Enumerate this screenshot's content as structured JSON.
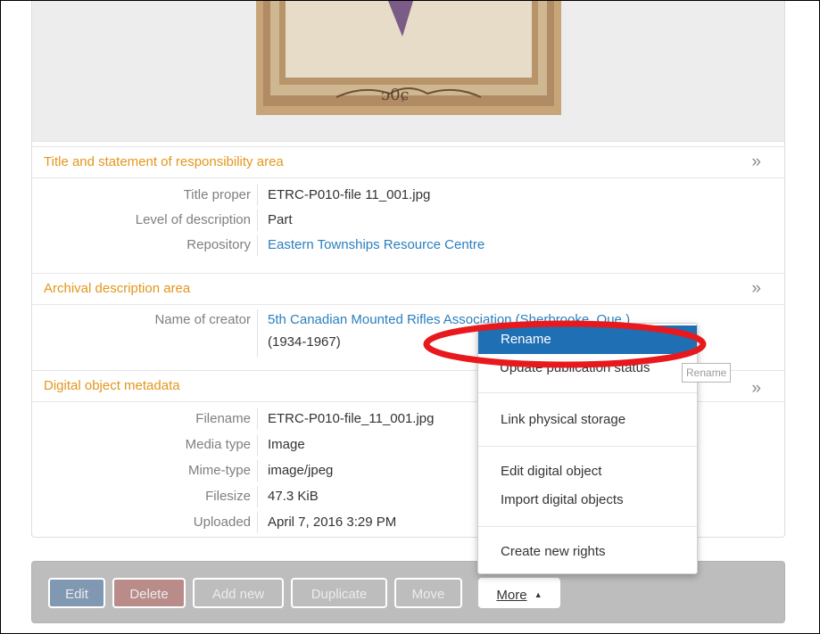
{
  "sections": {
    "title_area": {
      "title": "Title and statement of responsibility area",
      "fields": [
        {
          "label": "Title proper",
          "value": "ETRC-P010-file 11_001.jpg"
        },
        {
          "label": "Level of description",
          "value": "Part"
        },
        {
          "label": "Repository",
          "value": "Eastern Townships Resource Centre"
        }
      ]
    },
    "archival_area": {
      "title": "Archival description area",
      "fields": [
        {
          "label": "Name of creator",
          "value": "5th Canadian Mounted Rifles Association (Sherbrooke, Que.)",
          "value_line2": "(1934-1967)"
        }
      ]
    },
    "digital_area": {
      "title": "Digital object metadata",
      "fields": [
        {
          "label": "Filename",
          "value": "ETRC-P010-file_11_001.jpg"
        },
        {
          "label": "Media type",
          "value": "Image"
        },
        {
          "label": "Mime-type",
          "value": "image/jpeg"
        },
        {
          "label": "Filesize",
          "value": "47.3 KiB"
        },
        {
          "label": "Uploaded",
          "value": "April 7, 2016 3:29 PM"
        }
      ]
    },
    "chevron": "»"
  },
  "toolbar": {
    "edit": "Edit",
    "delete": "Delete",
    "add_new": "Add new",
    "duplicate": "Duplicate",
    "move": "Move",
    "more": "More",
    "more_caret": "▲"
  },
  "menu": {
    "items": [
      "Rename",
      "Update publication status",
      "Link physical storage",
      "Edit digital object",
      "Import digital objects",
      "Create new rights"
    ]
  },
  "tooltip": "Rename",
  "colors": {
    "section_title": "#e3961b",
    "link": "#2a7fbf",
    "highlight": "#1f6fb5",
    "annotation": "#e8191c",
    "edit_button": "#8198b3",
    "delete_button": "#b98c8a"
  }
}
